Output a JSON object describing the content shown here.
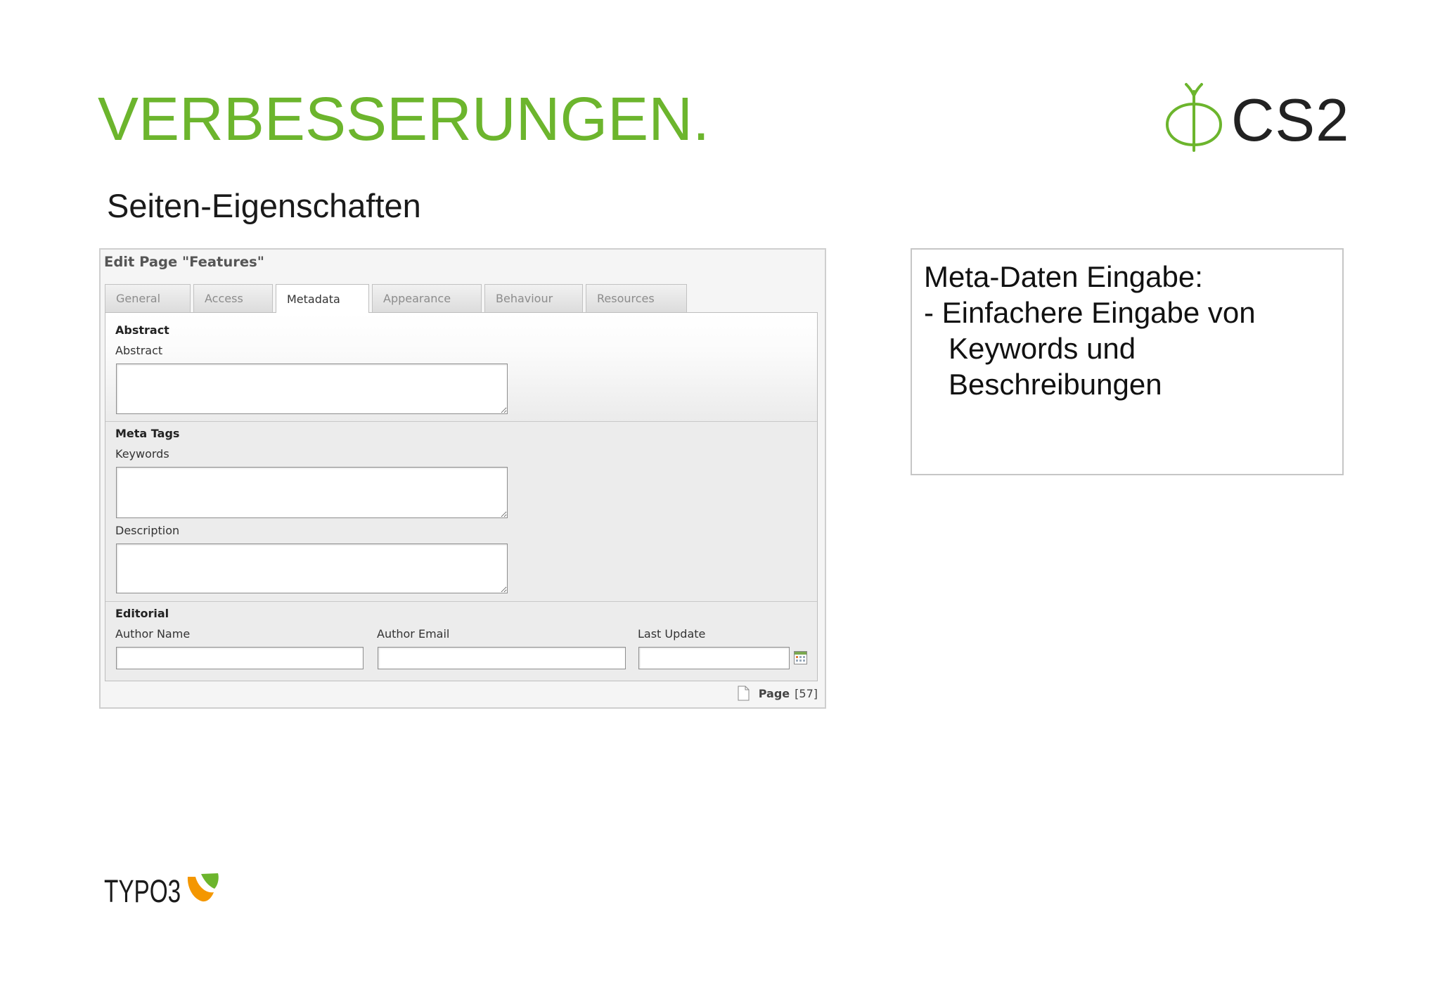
{
  "colors": {
    "title_green": "#6cb52d",
    "typo3_orange": "#f49700",
    "panel_border": "#cfcfcf"
  },
  "slide": {
    "title": "VERBESSERUNGEN.",
    "subtitle": "Seiten-Eigenschaften",
    "header_logo": {
      "icon": "cs2-leaf-icon",
      "text": "CS2"
    },
    "footer_logo": {
      "icon": "typo3-icon",
      "text": "TYPO3"
    }
  },
  "edit_panel": {
    "title": "Edit Page \"Features\"",
    "tabs": [
      {
        "label": "General",
        "active": false
      },
      {
        "label": "Access",
        "active": false
      },
      {
        "label": "Metadata",
        "active": true
      },
      {
        "label": "Appearance",
        "active": false
      },
      {
        "label": "Behaviour",
        "active": false
      },
      {
        "label": "Resources",
        "active": false
      }
    ],
    "sections": {
      "abstract": {
        "heading": "Abstract",
        "abstract": {
          "label": "Abstract",
          "value": ""
        }
      },
      "meta_tags": {
        "heading": "Meta Tags",
        "keywords": {
          "label": "Keywords",
          "value": ""
        },
        "description": {
          "label": "Description",
          "value": ""
        }
      },
      "editorial": {
        "heading": "Editorial",
        "author_name": {
          "label": "Author Name",
          "value": ""
        },
        "author_email": {
          "label": "Author Email",
          "value": ""
        },
        "last_update": {
          "label": "Last Update",
          "value": "",
          "icon": "calendar-icon"
        }
      }
    },
    "footer": {
      "icon": "page-icon",
      "record_type": "Page",
      "record_id": "[57]"
    }
  },
  "note_box": {
    "lines": [
      "Meta-Daten Eingabe:",
      "- Einfachere Eingabe von",
      "Keywords und",
      "Beschreibungen"
    ]
  }
}
